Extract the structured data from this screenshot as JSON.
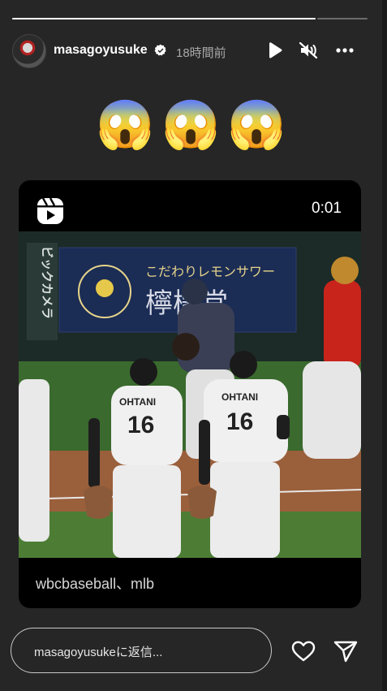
{
  "story": {
    "progress": [
      {
        "segment": 1,
        "fraction": 1.0
      },
      {
        "segment": 2,
        "fraction": 0.0
      }
    ],
    "header": {
      "username": "masagoyusuke",
      "timestamp": "18時間前",
      "icons": [
        "verified-badge-icon",
        "play-icon",
        "mute-icon",
        "more-icon"
      ]
    },
    "emojis": [
      "😱",
      "😱",
      "😱"
    ],
    "reel": {
      "icon": "reels-icon",
      "duration": "0:01",
      "tags": "wbcbaseball、mlb",
      "video": {
        "sign_slogan": "こだわりレモンサワー",
        "sign_brand": "檸檬堂",
        "side_sign": "ビックカメラ",
        "jersey_name": "OHTANI",
        "jersey_number": "16"
      }
    },
    "reply": {
      "placeholder": "masagoyusukeに返信...",
      "icons": [
        "heart-icon",
        "send-icon"
      ]
    }
  }
}
